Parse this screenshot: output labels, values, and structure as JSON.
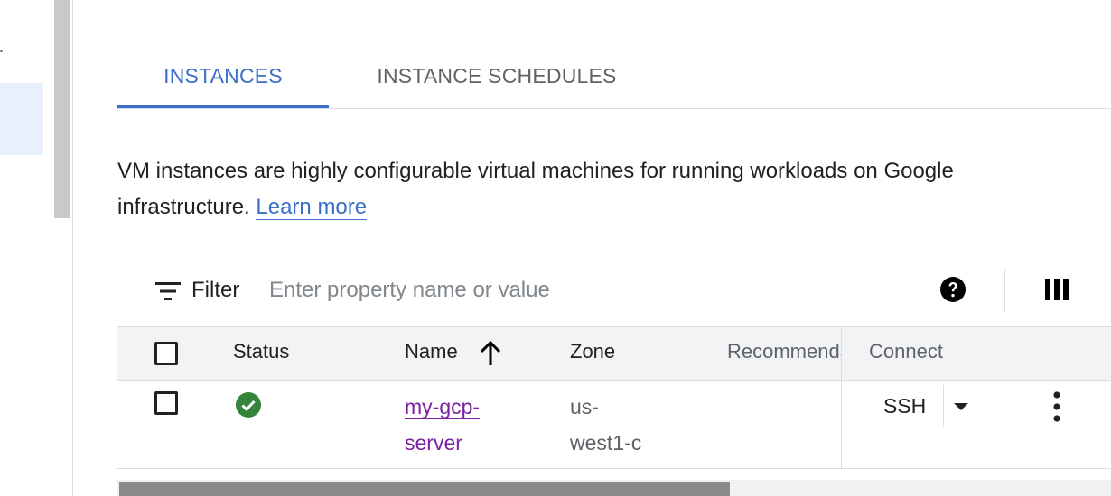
{
  "tabs": [
    {
      "label": "INSTANCES",
      "active": true
    },
    {
      "label": "INSTANCE SCHEDULES",
      "active": false
    }
  ],
  "description": {
    "text": "VM instances are highly configurable virtual machines for running workloads on Google infrastructure.",
    "link": "Learn more"
  },
  "filter": {
    "label": "Filter",
    "placeholder": "Enter property name or value",
    "value": ""
  },
  "table": {
    "columns": {
      "status": "Status",
      "name": "Name",
      "zone": "Zone",
      "recommendation": "Recommendation",
      "connect": "Connect"
    },
    "sort": {
      "column": "Name",
      "direction": "ascending"
    },
    "rows": [
      {
        "status": "running",
        "name_line1": "my-gcp-",
        "name_line2": "server",
        "zone_line1": "us-",
        "zone_line2": "west1-c",
        "connect": "SSH"
      }
    ]
  },
  "colors": {
    "accent": "#3b6fc9",
    "link_visited": "#7b1fa2",
    "status_ok": "#34853b",
    "header_bg": "#f1f3f4"
  },
  "icons": {
    "filter": "filter-icon",
    "help": "help-icon",
    "columns": "column-display-icon",
    "sort": "arrow-up-icon",
    "status": "check-circle-icon",
    "dropdown": "caret-down-icon",
    "more": "more-vert-icon"
  }
}
